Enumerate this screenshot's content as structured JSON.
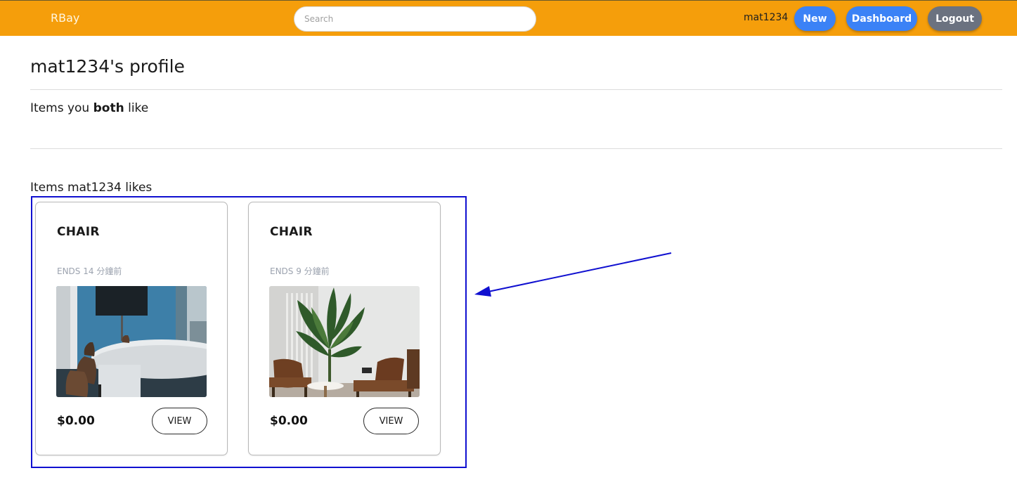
{
  "navbar": {
    "brand": "RBay",
    "search_placeholder": "Search",
    "username": "mat1234",
    "new_label": "New",
    "dashboard_label": "Dashboard",
    "logout_label": "Logout",
    "bg_color": "#f59e0b"
  },
  "profile": {
    "title": "mat1234's profile",
    "both_prefix": "Items you ",
    "both_bold": "both",
    "both_suffix": " like",
    "likes_heading": "Items mat1234 likes"
  },
  "items": [
    {
      "name": "CHAIR",
      "ends": "ENDS 14 分鐘前",
      "price": "$0.00",
      "view_label": "VIEW",
      "image": "conference-room-photo"
    },
    {
      "name": "CHAIR",
      "ends": "ENDS 9 分鐘前",
      "price": "$0.00",
      "view_label": "VIEW",
      "image": "lounge-chairs-plant-photo"
    }
  ],
  "colors": {
    "accent_blue": "#3b82f6",
    "logout_gray": "#6b7280",
    "annotation_blue": "#1010d0"
  }
}
